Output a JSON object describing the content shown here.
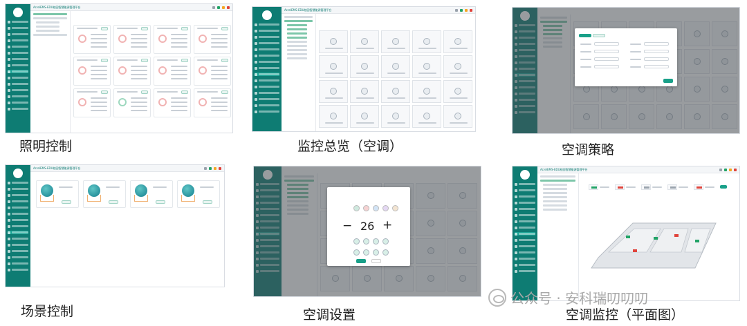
{
  "captions": {
    "lighting": "照明控制",
    "monitor_ac": "监控总览（空调）",
    "ac_strategy": "空调策略",
    "scene": "场景控制",
    "ac_settings": "空调设置",
    "ac_floorplan": "空调监控（平面图）"
  },
  "app_title": "AcrelEMS-EDU校园智慧能源管理平台",
  "dialog": {
    "temperature": "26",
    "minus": "−",
    "plus": "+"
  },
  "watermark": "公众号 · 安科瑞叨叨叨",
  "colors": {
    "sidebar": "#0e7c73",
    "accent": "#19a089"
  }
}
